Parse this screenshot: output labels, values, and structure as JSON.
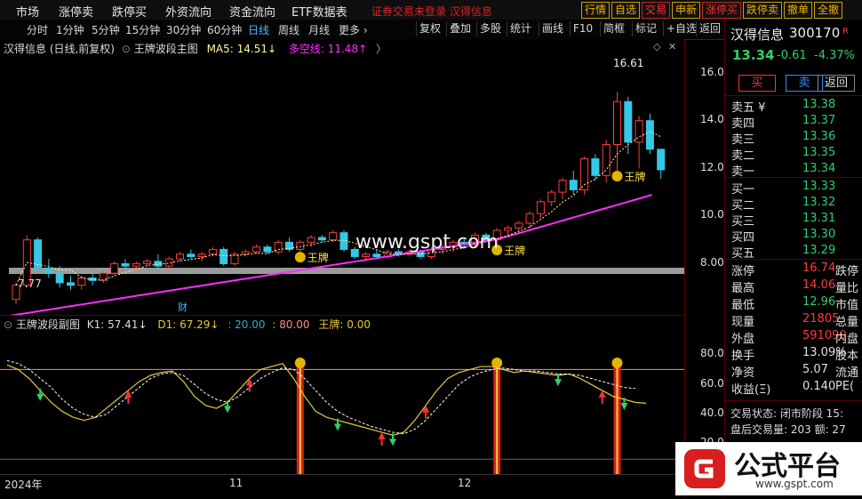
{
  "topnav": [
    "市场",
    "涨停卖",
    "跌停买",
    "外资流向",
    "资金流向",
    "ETF数据表"
  ],
  "notice": "证券交易未登录  汉得信息",
  "order_buttons": [
    {
      "label": "行情",
      "style": "gold"
    },
    {
      "label": "自选",
      "style": "gold"
    },
    {
      "label": "交易",
      "style": "red"
    },
    {
      "label": "申新",
      "style": "gold"
    },
    {
      "label": "涨停买",
      "style": "red"
    },
    {
      "label": "跌停卖",
      "style": "gold"
    },
    {
      "label": "撤单",
      "style": "gold"
    },
    {
      "label": "全撤",
      "style": "gold"
    }
  ],
  "toolbar": {
    "periods": [
      "分时",
      "1分钟",
      "5分钟",
      "15分钟",
      "30分钟",
      "60分钟",
      "日线",
      "周线",
      "月线",
      "更多 ›"
    ],
    "active": "日线",
    "actions": [
      "复权",
      "叠加",
      "多股",
      "统计",
      "画线",
      "F10",
      "简框",
      "标记",
      "+自选",
      "返回"
    ]
  },
  "main_legend": {
    "title": "汉得信息 (日线,前复权)",
    "indicator": "王牌波段主图",
    "ma5": "MA5: 14.51↓",
    "multi_line": "多空线: 11.48↑"
  },
  "sub_legend": {
    "indicator": "王牌波段副图",
    "k1": "K1: 57.41↓",
    "d1": "D1: 67.29↓",
    "l20": ": 20.00",
    "l80": ": 80.00",
    "wp": "王牌: 0.00"
  },
  "labels": {
    "high": "16.61",
    "low": "7.77",
    "cai": "财",
    "wp": "王牌",
    "watermark": "www.gspt.com"
  },
  "main_ticks": [
    "16.00",
    "14.00",
    "12.00",
    "10.00",
    "8.00"
  ],
  "sub_ticks": [
    "80.00",
    "60.00",
    "40.00",
    "20.00"
  ],
  "dates": [
    "2024年",
    "11",
    "12"
  ],
  "quote": {
    "name": "汉得信息",
    "code": "300170",
    "tag": "R",
    "price": "13.34",
    "change": "-0.61",
    "pct": "-4.37%",
    "buy": "买",
    "sell": "卖",
    "back": "返回",
    "asks": [
      [
        "卖五 ¥",
        "13.38"
      ],
      [
        "卖四",
        "13.37"
      ],
      [
        "卖三",
        "13.36"
      ],
      [
        "卖二",
        "13.35"
      ],
      [
        "卖一",
        "13.34"
      ]
    ],
    "bids": [
      [
        "买一",
        "13.33"
      ],
      [
        "买二",
        "13.32"
      ],
      [
        "买三",
        "13.31"
      ],
      [
        "买四",
        "13.30"
      ],
      [
        "买五",
        "13.29"
      ]
    ],
    "stats": [
      [
        "涨停",
        "16.74",
        "跌停"
      ],
      [
        "最高",
        "14.06",
        "量比"
      ],
      [
        "最低",
        "12.96",
        "市值"
      ],
      [
        "现量",
        "21805",
        "总量"
      ],
      [
        "外盘",
        "591090",
        "内盘"
      ],
      [
        "换手",
        "13.09%",
        "股本"
      ],
      [
        "净资",
        "5.07",
        "流通"
      ],
      [
        "收益(Ξ)",
        "0.140",
        "PE("
      ]
    ],
    "status": "交易状态: 闭市阶段 15:",
    "after": "盘后交易量: 203  额: 27"
  },
  "logo": {
    "text": "公式平台",
    "url": "www.gspt.com"
  },
  "colors": {
    "up": "#ff3b3b",
    "down": "#2ed06a",
    "ma": "#ff2cff",
    "accent": "#f0b000"
  },
  "chart_data": [
    {
      "type": "candlestick",
      "title": "汉得信息 (日线,前复权)",
      "series": [
        {
          "name": "MA5",
          "last": 14.51
        },
        {
          "name": "多空线",
          "last": 11.48
        }
      ],
      "ohlc": [
        [
          7.9,
          7.7,
          8.6,
          8.5
        ],
        [
          8.5,
          8.4,
          10.6,
          10.4
        ],
        [
          10.4,
          9.1,
          10.5,
          9.2
        ],
        [
          9.2,
          8.8,
          9.6,
          9.0
        ],
        [
          9.0,
          8.4,
          9.3,
          8.6
        ],
        [
          8.6,
          8.3,
          8.9,
          8.5
        ],
        [
          8.5,
          8.3,
          8.9,
          8.8
        ],
        [
          8.8,
          8.5,
          9.0,
          8.7
        ],
        [
          8.7,
          8.6,
          9.1,
          9.0
        ],
        [
          9.0,
          8.9,
          9.5,
          9.4
        ],
        [
          9.4,
          9.2,
          9.6,
          9.3
        ],
        [
          9.3,
          9.1,
          9.5,
          9.4
        ],
        [
          9.4,
          9.3,
          9.6,
          9.5
        ],
        [
          9.5,
          9.2,
          9.8,
          9.3
        ],
        [
          9.3,
          9.2,
          9.7,
          9.6
        ],
        [
          9.6,
          9.5,
          9.9,
          9.8
        ],
        [
          9.8,
          9.6,
          10.0,
          9.7
        ],
        [
          9.7,
          9.5,
          9.9,
          9.8
        ],
        [
          9.8,
          9.7,
          10.1,
          10.0
        ],
        [
          10.0,
          9.3,
          10.1,
          9.4
        ],
        [
          9.4,
          9.3,
          9.9,
          9.8
        ],
        [
          9.8,
          9.7,
          10.0,
          9.9
        ],
        [
          9.9,
          9.8,
          10.2,
          10.1
        ],
        [
          10.1,
          9.8,
          10.2,
          9.9
        ],
        [
          9.9,
          9.8,
          10.4,
          10.3
        ],
        [
          10.3,
          9.9,
          10.5,
          10.0
        ],
        [
          10.0,
          9.9,
          10.4,
          10.3
        ],
        [
          10.3,
          10.1,
          10.6,
          10.5
        ],
        [
          10.5,
          10.3,
          10.6,
          10.4
        ],
        [
          10.4,
          10.3,
          10.8,
          10.7
        ],
        [
          10.7,
          9.9,
          10.8,
          10.0
        ],
        [
          10.0,
          9.6,
          10.1,
          9.7
        ],
        [
          9.7,
          9.5,
          9.9,
          9.8
        ],
        [
          9.8,
          9.6,
          10.0,
          9.7
        ],
        [
          9.7,
          9.6,
          10.0,
          9.9
        ],
        [
          9.9,
          9.7,
          10.0,
          9.8
        ],
        [
          9.8,
          9.7,
          10.0,
          9.9
        ],
        [
          9.9,
          9.6,
          10.0,
          9.7
        ],
        [
          9.7,
          9.6,
          10.1,
          10.0
        ],
        [
          10.0,
          9.8,
          10.2,
          10.1
        ],
        [
          10.1,
          9.9,
          10.4,
          10.3
        ],
        [
          10.3,
          10.1,
          10.5,
          10.2
        ],
        [
          10.2,
          10.1,
          10.7,
          10.6
        ],
        [
          10.6,
          10.3,
          10.7,
          10.4
        ],
        [
          10.4,
          10.2,
          10.9,
          10.8
        ],
        [
          10.8,
          10.6,
          11.0,
          10.9
        ],
        [
          10.9,
          10.7,
          11.2,
          11.1
        ],
        [
          11.1,
          10.9,
          11.6,
          11.5
        ],
        [
          11.5,
          11.3,
          12.1,
          12.0
        ],
        [
          12.0,
          11.8,
          12.5,
          12.4
        ],
        [
          12.4,
          12.1,
          13.0,
          12.9
        ],
        [
          12.9,
          12.3,
          13.3,
          12.5
        ],
        [
          12.5,
          12.3,
          13.9,
          13.8
        ],
        [
          13.8,
          12.9,
          14.0,
          13.1
        ],
        [
          13.1,
          12.8,
          14.6,
          14.4
        ],
        [
          14.4,
          13.3,
          16.6,
          16.2
        ],
        [
          16.2,
          14.0,
          16.4,
          14.5
        ],
        [
          14.5,
          13.4,
          15.6,
          15.4
        ],
        [
          15.4,
          14.0,
          15.7,
          14.2
        ],
        [
          14.2,
          12.96,
          14.06,
          13.34
        ]
      ]
    },
    {
      "type": "line",
      "title": "王牌波段副图",
      "ylim": [
        20,
        90
      ],
      "series": [
        {
          "name": "K1",
          "last": 57.41,
          "values": [
            83,
            80,
            74,
            66,
            58,
            52,
            48,
            46,
            48,
            54,
            60,
            66,
            72,
            76,
            78,
            79,
            72,
            62,
            56,
            54,
            58,
            66,
            74,
            80,
            82,
            84,
            74,
            62,
            52,
            48,
            46,
            44,
            42,
            40,
            38,
            36,
            38,
            46,
            56,
            66,
            74,
            78,
            80,
            82,
            82,
            80,
            78,
            79,
            78,
            77,
            76,
            77,
            74,
            70,
            66,
            62,
            60,
            58,
            57.41
          ]
        },
        {
          "name": "D1",
          "last": 67.29,
          "values": [
            86,
            84,
            80,
            74,
            68,
            60,
            54,
            50,
            48,
            50,
            56,
            62,
            68,
            74,
            77,
            78,
            76,
            70,
            64,
            60,
            58,
            62,
            68,
            74,
            78,
            81,
            80,
            74,
            66,
            58,
            52,
            48,
            45,
            42,
            40,
            38,
            37,
            40,
            46,
            54,
            62,
            70,
            75,
            78,
            80,
            81,
            80,
            79,
            79,
            78,
            77,
            77,
            76,
            74,
            72,
            70,
            68,
            67.29
          ]
        },
        {
          "name": "王牌",
          "last": 0.0
        }
      ],
      "reference_lines": [
        20,
        80
      ]
    }
  ]
}
